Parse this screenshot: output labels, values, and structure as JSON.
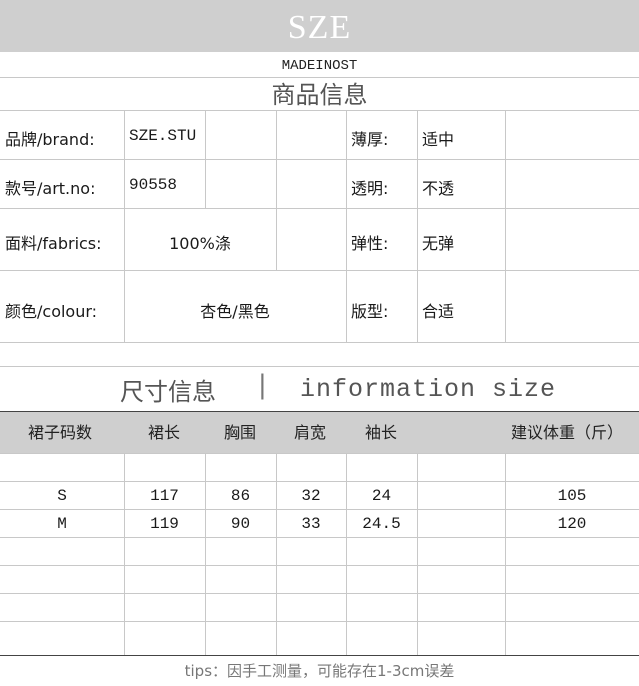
{
  "header": {
    "brand_title": "SZE",
    "made_in": "MADEINOST",
    "section_title": "商品信息"
  },
  "product": {
    "brand_label": "品牌/brand:",
    "brand_value": "SZE.STU",
    "thickness_label": "薄厚:",
    "thickness_value": "适中",
    "art_label": "款号/art.no:",
    "art_value": "90558",
    "transparency_label": "透明:",
    "transparency_value": "不透",
    "fabric_label": "面料/fabrics:",
    "fabric_value": "100%涤",
    "elasticity_label": "弹性:",
    "elasticity_value": "无弹",
    "colour_label": "颜色/colour:",
    "colour_value": "杏色/黑色",
    "fit_label": "版型:",
    "fit_value": "合适"
  },
  "size_section": {
    "title_cn": "尺寸信息",
    "separator": "|",
    "title_en": "information size"
  },
  "size_table": {
    "headers": [
      "裙子码数",
      "裙长",
      "胸围",
      "肩宽",
      "袖长",
      "建议体重（斤）"
    ],
    "rows": [
      [
        "S",
        "117",
        "86",
        "32",
        "24",
        "105"
      ],
      [
        "M",
        "119",
        "90",
        "33",
        "24.5",
        "120"
      ]
    ]
  },
  "footer": {
    "tips": "tips：因手工测量，可能存在1-3cm误差"
  }
}
